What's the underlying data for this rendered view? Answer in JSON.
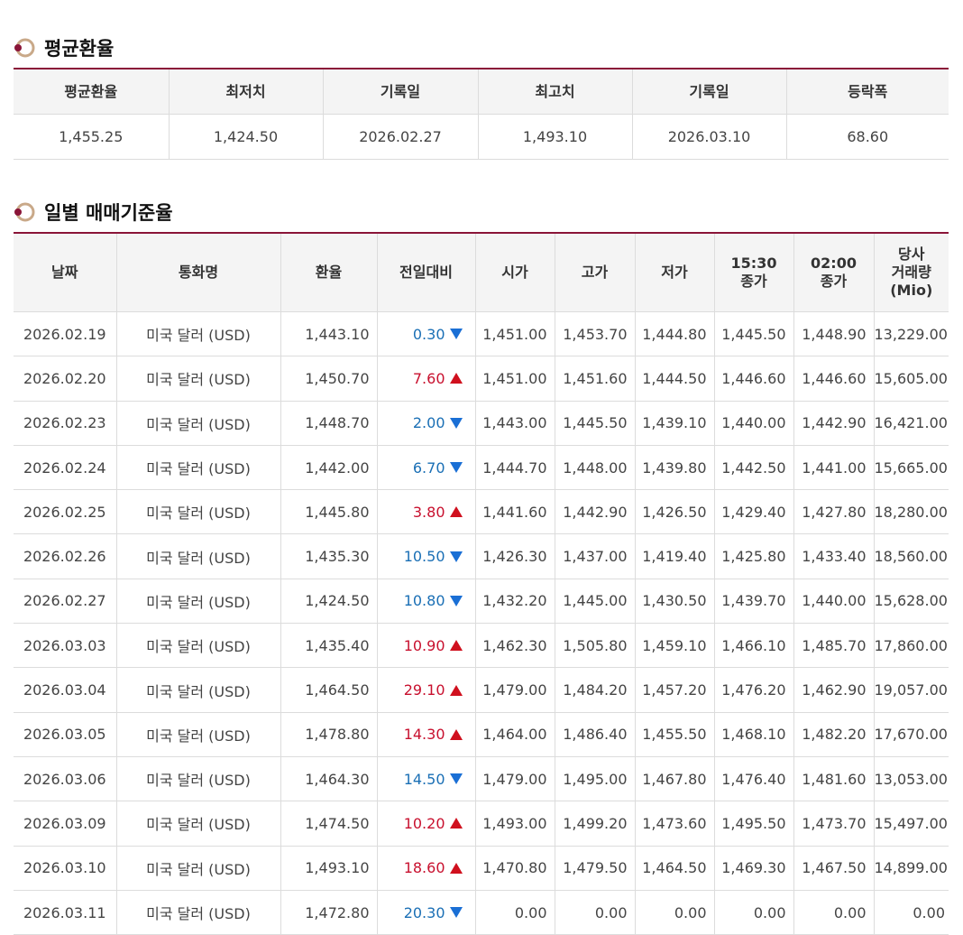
{
  "avg_section": {
    "title": "평균환율",
    "headers": [
      "평균환율",
      "최저치",
      "기록일",
      "최고치",
      "기록일",
      "등락폭"
    ],
    "values": [
      "1,455.25",
      "1,424.50",
      "2026.02.27",
      "1,493.10",
      "2026.03.10",
      "68.60"
    ]
  },
  "daily_section": {
    "title": "일별 매매기준율",
    "headers": [
      "날짜",
      "통화명",
      "환율",
      "전일대비",
      "시가",
      "고가",
      "저가",
      "15:30\n종가",
      "02:00\n종가",
      "당사\n거래량\n(Mio)"
    ],
    "rows": [
      {
        "date": "2026.02.19",
        "currency": "미국 달러 (USD)",
        "rate": "1,443.10",
        "change": "0.30",
        "dir": "down",
        "open": "1,451.00",
        "high": "1,453.70",
        "low": "1,444.80",
        "close1530": "1,445.50",
        "close0200": "1,448.90",
        "volume": "13,229.00"
      },
      {
        "date": "2026.02.20",
        "currency": "미국 달러 (USD)",
        "rate": "1,450.70",
        "change": "7.60",
        "dir": "up",
        "open": "1,451.00",
        "high": "1,451.60",
        "low": "1,444.50",
        "close1530": "1,446.60",
        "close0200": "1,446.60",
        "volume": "15,605.00"
      },
      {
        "date": "2026.02.23",
        "currency": "미국 달러 (USD)",
        "rate": "1,448.70",
        "change": "2.00",
        "dir": "down",
        "open": "1,443.00",
        "high": "1,445.50",
        "low": "1,439.10",
        "close1530": "1,440.00",
        "close0200": "1,442.90",
        "volume": "16,421.00"
      },
      {
        "date": "2026.02.24",
        "currency": "미국 달러 (USD)",
        "rate": "1,442.00",
        "change": "6.70",
        "dir": "down",
        "open": "1,444.70",
        "high": "1,448.00",
        "low": "1,439.80",
        "close1530": "1,442.50",
        "close0200": "1,441.00",
        "volume": "15,665.00"
      },
      {
        "date": "2026.02.25",
        "currency": "미국 달러 (USD)",
        "rate": "1,445.80",
        "change": "3.80",
        "dir": "up",
        "open": "1,441.60",
        "high": "1,442.90",
        "low": "1,426.50",
        "close1530": "1,429.40",
        "close0200": "1,427.80",
        "volume": "18,280.00"
      },
      {
        "date": "2026.02.26",
        "currency": "미국 달러 (USD)",
        "rate": "1,435.30",
        "change": "10.50",
        "dir": "down",
        "open": "1,426.30",
        "high": "1,437.00",
        "low": "1,419.40",
        "close1530": "1,425.80",
        "close0200": "1,433.40",
        "volume": "18,560.00"
      },
      {
        "date": "2026.02.27",
        "currency": "미국 달러 (USD)",
        "rate": "1,424.50",
        "change": "10.80",
        "dir": "down",
        "open": "1,432.20",
        "high": "1,445.00",
        "low": "1,430.50",
        "close1530": "1,439.70",
        "close0200": "1,440.00",
        "volume": "15,628.00"
      },
      {
        "date": "2026.03.03",
        "currency": "미국 달러 (USD)",
        "rate": "1,435.40",
        "change": "10.90",
        "dir": "up",
        "open": "1,462.30",
        "high": "1,505.80",
        "low": "1,459.10",
        "close1530": "1,466.10",
        "close0200": "1,485.70",
        "volume": "17,860.00"
      },
      {
        "date": "2026.03.04",
        "currency": "미국 달러 (USD)",
        "rate": "1,464.50",
        "change": "29.10",
        "dir": "up",
        "open": "1,479.00",
        "high": "1,484.20",
        "low": "1,457.20",
        "close1530": "1,476.20",
        "close0200": "1,462.90",
        "volume": "19,057.00"
      },
      {
        "date": "2026.03.05",
        "currency": "미국 달러 (USD)",
        "rate": "1,478.80",
        "change": "14.30",
        "dir": "up",
        "open": "1,464.00",
        "high": "1,486.40",
        "low": "1,455.50",
        "close1530": "1,468.10",
        "close0200": "1,482.20",
        "volume": "17,670.00"
      },
      {
        "date": "2026.03.06",
        "currency": "미국 달러 (USD)",
        "rate": "1,464.30",
        "change": "14.50",
        "dir": "down",
        "open": "1,479.00",
        "high": "1,495.00",
        "low": "1,467.80",
        "close1530": "1,476.40",
        "close0200": "1,481.60",
        "volume": "13,053.00"
      },
      {
        "date": "2026.03.09",
        "currency": "미국 달러 (USD)",
        "rate": "1,474.50",
        "change": "10.20",
        "dir": "up",
        "open": "1,493.00",
        "high": "1,499.20",
        "low": "1,473.60",
        "close1530": "1,495.50",
        "close0200": "1,473.70",
        "volume": "15,497.00"
      },
      {
        "date": "2026.03.10",
        "currency": "미국 달러 (USD)",
        "rate": "1,493.10",
        "change": "18.60",
        "dir": "up",
        "open": "1,470.80",
        "high": "1,479.50",
        "low": "1,464.50",
        "close1530": "1,469.30",
        "close0200": "1,467.50",
        "volume": "14,899.00"
      },
      {
        "date": "2026.03.11",
        "currency": "미국 달러 (USD)",
        "rate": "1,472.80",
        "change": "20.30",
        "dir": "down",
        "open": "0.00",
        "high": "0.00",
        "low": "0.00",
        "close1530": "0.00",
        "close0200": "0.00",
        "volume": "0.00"
      }
    ]
  },
  "icons": {
    "section_icon": "ring-bullet-icon",
    "up": "triangle-up-icon",
    "down": "triangle-down-icon"
  },
  "colors": {
    "accent_border": "#8a1538",
    "up": "#c8102e",
    "down": "#1a6fb5"
  }
}
